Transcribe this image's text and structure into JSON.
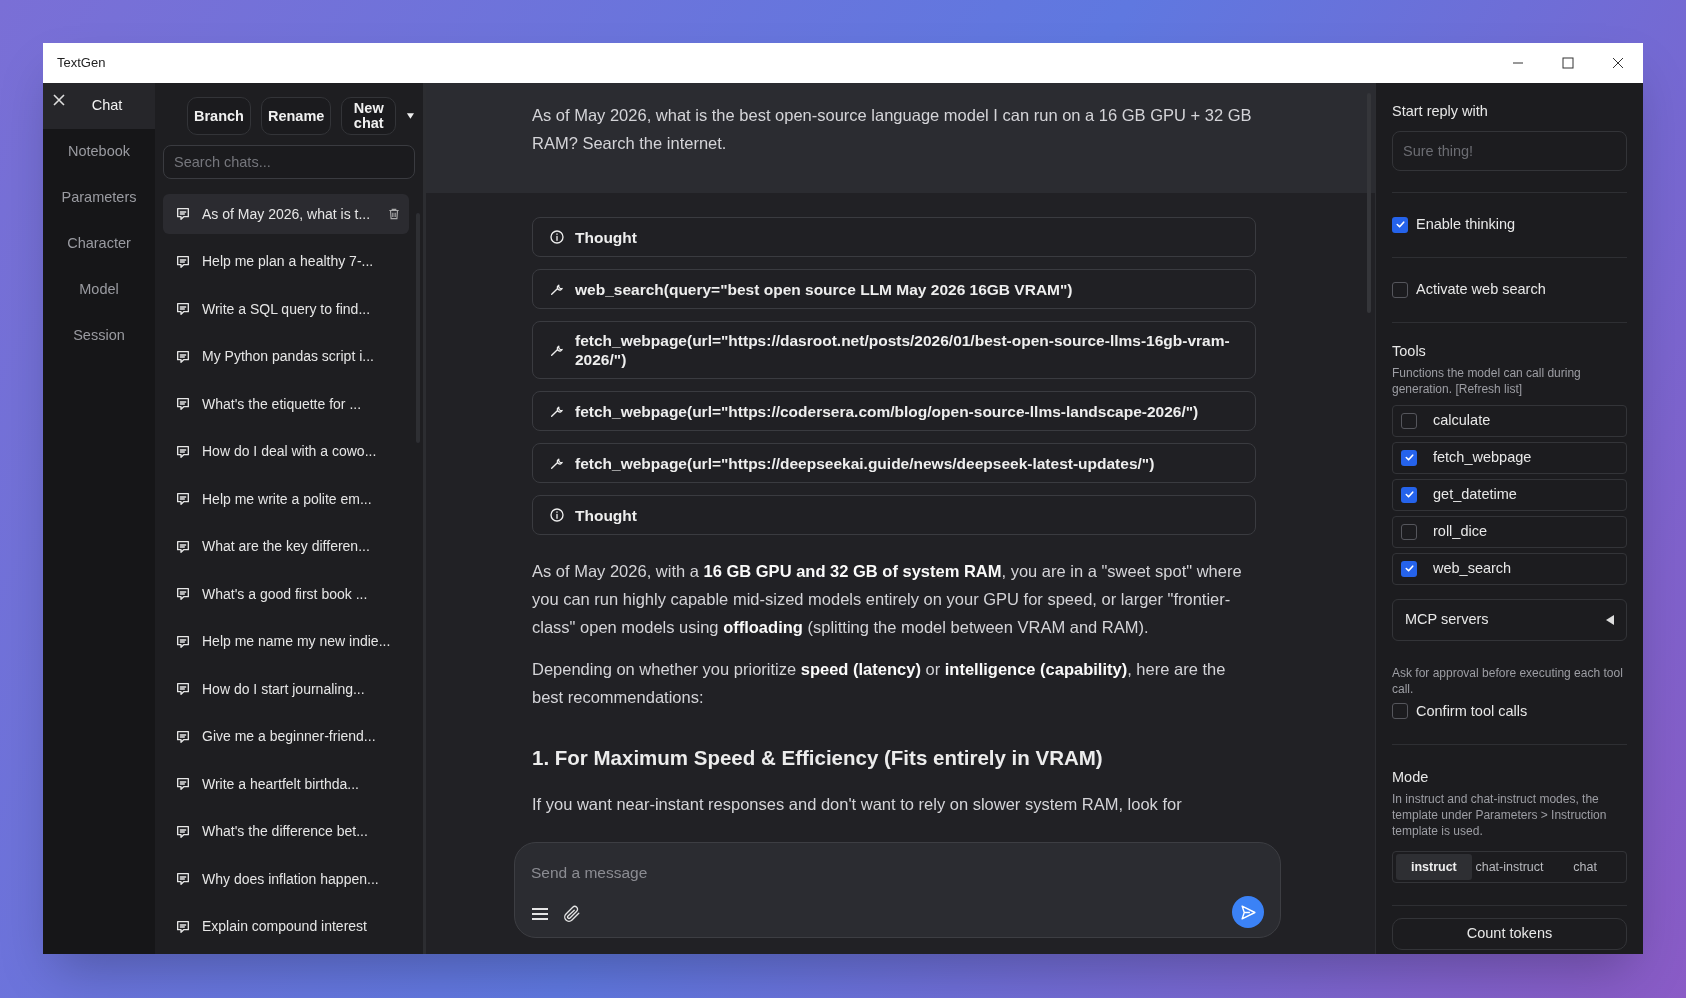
{
  "window": {
    "title": "TextGen"
  },
  "nav": {
    "items": [
      {
        "label": "Chat",
        "selected": true
      },
      {
        "label": "Notebook",
        "selected": false
      },
      {
        "label": "Parameters",
        "selected": false
      },
      {
        "label": "Character",
        "selected": false
      },
      {
        "label": "Model",
        "selected": false
      },
      {
        "label": "Session",
        "selected": false
      }
    ]
  },
  "chat_toolbar": {
    "buttons": [
      "Branch",
      "Rename",
      "New chat"
    ]
  },
  "search": {
    "placeholder": "Search chats..."
  },
  "chats": [
    {
      "title": "As of May 2026, what is t...",
      "selected": true
    },
    {
      "title": "Help me plan a healthy 7-...",
      "selected": false
    },
    {
      "title": "Write a SQL query to find...",
      "selected": false
    },
    {
      "title": "My Python pandas script i...",
      "selected": false
    },
    {
      "title": "What's the etiquette for ...",
      "selected": false
    },
    {
      "title": "How do I deal with a cowo...",
      "selected": false
    },
    {
      "title": "Help me write a polite em...",
      "selected": false
    },
    {
      "title": "What are the key differen...",
      "selected": false
    },
    {
      "title": "What's a good first book ...",
      "selected": false
    },
    {
      "title": "Help me name my new indie...",
      "selected": false
    },
    {
      "title": "How do I start journaling...",
      "selected": false
    },
    {
      "title": "Give me a beginner-friend...",
      "selected": false
    },
    {
      "title": "Write a heartfelt birthda...",
      "selected": false
    },
    {
      "title": "What's the difference bet...",
      "selected": false
    },
    {
      "title": "Why does inflation happen...",
      "selected": false
    },
    {
      "title": "Explain compound interest",
      "selected": false
    }
  ],
  "user_message": "As of May 2026, what is the best open-source language model I can run on a 16 GB GPU + 32 GB RAM? Search the internet.",
  "steps": [
    {
      "kind": "thought",
      "label": "Thought"
    },
    {
      "kind": "tool",
      "label": "web_search(query=\"best open source LLM May 2026 16GB VRAM\")"
    },
    {
      "kind": "tool",
      "label": "fetch_webpage(url=\"https://dasroot.net/posts/2026/01/best-open-source-llms-16gb-vram-2026/\")"
    },
    {
      "kind": "tool",
      "label": "fetch_webpage(url=\"https://codersera.com/blog/open-source-llms-landscape-2026/\")"
    },
    {
      "kind": "tool",
      "label": "fetch_webpage(url=\"https://deepseekai.guide/news/deepseek-latest-updates/\")"
    },
    {
      "kind": "thought",
      "label": "Thought"
    }
  ],
  "response": [
    {
      "kind": "paragraph",
      "text": "As of May 2026, with a **16 GB GPU and 32 GB of system RAM**, you are in a \"sweet spot\" where you can run highly capable mid-sized models entirely on your GPU for speed, or larger \"frontier-class\" open models using **offloading** (splitting the model between VRAM and RAM)."
    },
    {
      "kind": "paragraph",
      "text": "Depending on whether you prioritize **speed (latency)** or **intelligence (capability)**, here are the best recommendations:"
    },
    {
      "kind": "heading",
      "text": "1. For Maximum Speed & Efficiency (Fits entirely in VRAM)"
    },
    {
      "kind": "paragraph",
      "text": "If you want near-instant responses and don't want to rely on slower system RAM, look for"
    }
  ],
  "composer": {
    "placeholder": "Send a message"
  },
  "start_reply": {
    "label": "Start reply with",
    "placeholder": "Sure thing!"
  },
  "enable_thinking": {
    "label": "Enable thinking",
    "checked": true
  },
  "web_search": {
    "label": "Activate web search",
    "checked": false
  },
  "tools": {
    "title": "Tools",
    "description": "Functions the model can call during generation. [Refresh list]",
    "items": [
      {
        "name": "calculate",
        "checked": false
      },
      {
        "name": "fetch_webpage",
        "checked": true
      },
      {
        "name": "get_datetime",
        "checked": true
      },
      {
        "name": "roll_dice",
        "checked": false
      },
      {
        "name": "web_search",
        "checked": true
      }
    ]
  },
  "mcp_servers": {
    "label": "MCP servers",
    "expanded": false
  },
  "confirm": {
    "description": "Ask for approval before executing each tool call.",
    "label": "Confirm tool calls",
    "checked": false
  },
  "mode": {
    "title": "Mode",
    "description": "In instruct and chat-instruct modes, the template under Parameters > Instruction template is used.",
    "options": [
      {
        "label": "instruct",
        "selected": true
      },
      {
        "label": "chat-instruct",
        "selected": false
      },
      {
        "label": "chat",
        "selected": false
      }
    ]
  },
  "count_tokens": "Count tokens"
}
